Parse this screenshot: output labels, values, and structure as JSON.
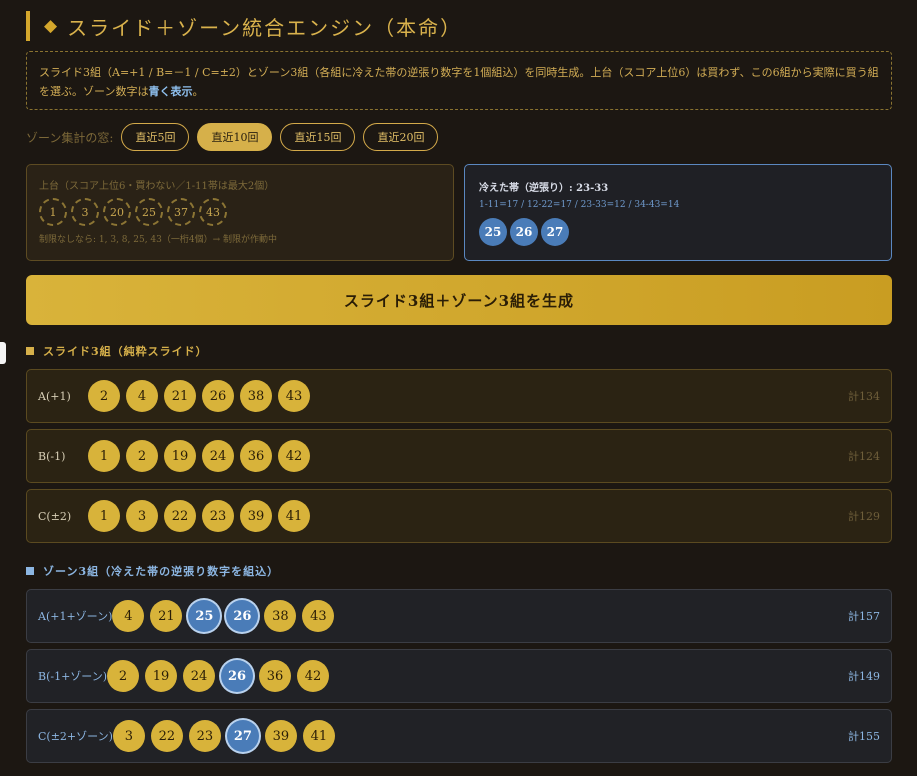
{
  "title": "スライド＋ゾーン統合エンジン（本命）",
  "title_icon": "◆",
  "info": {
    "text": "スライド3組（A=+1 / B=－1 / C=±2）とゾーン3組（各組に冷えた帯の逆張り数字を1個組込）を同時生成。上台（スコア上位6）は買わず、この6組から実際に買う組を選ぶ。ゾーン数字は",
    "highlight": "青く表示",
    "end": "。"
  },
  "window": {
    "label": "ゾーン集計の窓:",
    "options": [
      "直近5回",
      "直近10回",
      "直近15回",
      "直近20回"
    ],
    "active_index": 1
  },
  "top_panel": {
    "title": "上台（スコア上位6・買わない／1-11帯は最大2個）",
    "numbers": [
      "1",
      "3",
      "20",
      "25",
      "37",
      "43"
    ],
    "note": "制限なしなら: 1, 3, 8, 25, 43（一桁4個）→ 制限が作動中"
  },
  "cold_panel": {
    "title": "冷えた帯（逆張り）: 23-33",
    "subtitle": "1-11=17 / 12-22=17 / 23-33=12 / 34-43=14",
    "numbers": [
      "25",
      "26",
      "27"
    ]
  },
  "generate_button": "スライド3組＋ゾーン3組を生成",
  "slide_section": {
    "title": "スライド3組（純粋スライド）",
    "rows": [
      {
        "label": "A(+1)",
        "numbers": [
          "2",
          "4",
          "21",
          "26",
          "38",
          "43"
        ],
        "total": "計134"
      },
      {
        "label": "B(-1)",
        "numbers": [
          "1",
          "2",
          "19",
          "24",
          "36",
          "42"
        ],
        "total": "計124"
      },
      {
        "label": "C(±2)",
        "numbers": [
          "1",
          "3",
          "22",
          "23",
          "39",
          "41"
        ],
        "total": "計129"
      }
    ]
  },
  "zone_section": {
    "title": "ゾーン3組（冷えた帯の逆張り数字を組込）",
    "rows": [
      {
        "label": "A(+1+ゾーン)",
        "numbers": [
          "4",
          "21",
          "25",
          "26",
          "38",
          "43"
        ],
        "cold": [
          false,
          false,
          true,
          true,
          false,
          false
        ],
        "total": "計157"
      },
      {
        "label": "B(-1+ゾーン)",
        "numbers": [
          "2",
          "19",
          "24",
          "26",
          "36",
          "42"
        ],
        "cold": [
          false,
          false,
          false,
          true,
          false,
          false
        ],
        "total": "計149"
      },
      {
        "label": "C(±2+ゾーン)",
        "numbers": [
          "3",
          "22",
          "23",
          "27",
          "39",
          "41"
        ],
        "cold": [
          false,
          false,
          false,
          true,
          false,
          false
        ],
        "total": "計155"
      }
    ]
  },
  "colors": {
    "gold": "#d6b04a",
    "blue": "#4a7cb8",
    "background": "#1c1712"
  }
}
